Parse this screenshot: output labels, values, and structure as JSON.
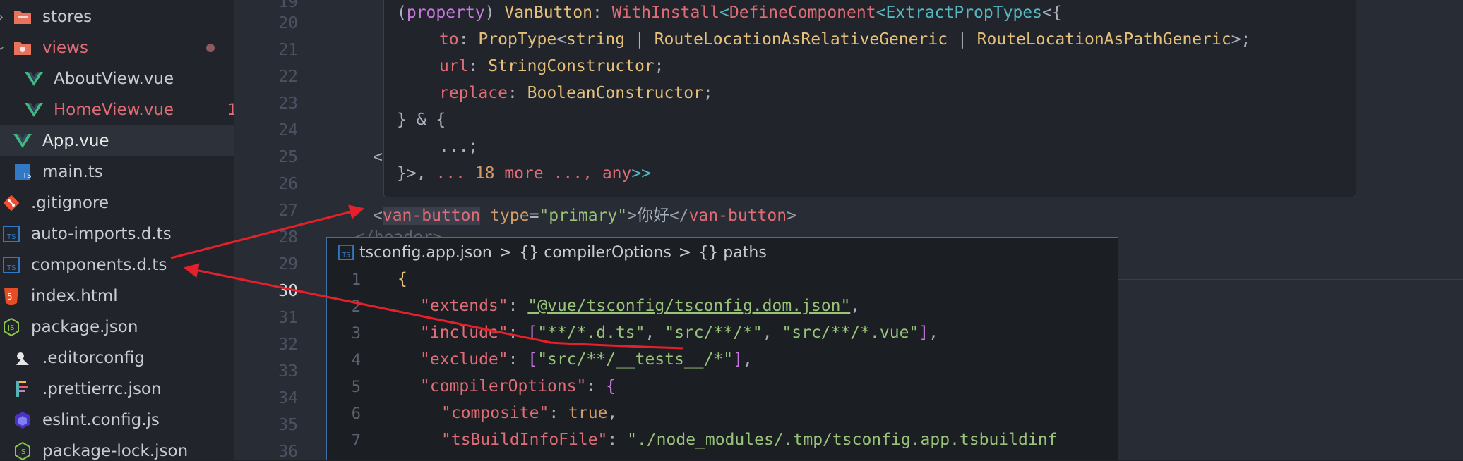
{
  "sidebar": {
    "items": [
      {
        "label": "stores",
        "icon": "folder-icon"
      },
      {
        "label": "views",
        "icon": "folder-open-icon"
      },
      {
        "label": "AboutView.vue",
        "icon": "vue-icon"
      },
      {
        "label": "HomeView.vue",
        "icon": "vue-icon",
        "badge": "1"
      },
      {
        "label": "App.vue",
        "icon": "vue-icon"
      },
      {
        "label": "main.ts",
        "icon": "ts-icon"
      },
      {
        "label": ".gitignore",
        "icon": "git-icon"
      },
      {
        "label": "auto-imports.d.ts",
        "icon": "ts-icon"
      },
      {
        "label": "components.d.ts",
        "icon": "ts-icon"
      },
      {
        "label": "index.html",
        "icon": "html-icon"
      },
      {
        "label": "package.json",
        "icon": "node-icon"
      },
      {
        "label": ".editorconfig",
        "icon": "editorconfig-icon"
      },
      {
        "label": ".prettierrc.json",
        "icon": "prettier-icon"
      },
      {
        "label": "eslint.config.js",
        "icon": "eslint-icon"
      },
      {
        "label": "package-lock.json",
        "icon": "node-icon"
      }
    ]
  },
  "editor": {
    "line_numbers": [
      "19",
      "20",
      "21",
      "22",
      "23",
      "24",
      "25",
      "26",
      "27",
      "28",
      "29",
      "30",
      "31",
      "32",
      "33",
      "34",
      "35",
      "36"
    ],
    "current_line": "30",
    "line25": "<",
    "line27": {
      "open": "<",
      "tag": "van-button",
      "attr": "type",
      "eq": "=",
      "val": "\"primary\"",
      "gt": ">",
      "text": "你好",
      "close_open": "</",
      "close_tag": "van-button",
      "close_gt": ">"
    },
    "line28": "</header>"
  },
  "hover": {
    "l1": {
      "a": "(",
      "b": "property",
      "c": ") ",
      "d": "VanButton",
      "e": ": ",
      "f": "WithInstall",
      "g": "<",
      "h": "DefineComponent",
      "i": "<",
      "j": "ExtractPropTypes",
      "k": "<{"
    },
    "l2": {
      "a": "to",
      "b": ": ",
      "c": "PropType",
      "d": "<",
      "e": "string",
      "f": " | ",
      "g": "RouteLocationAsRelativeGeneric",
      "h": " | ",
      "i": "RouteLocationAsPathGeneric",
      "j": ">;"
    },
    "l3": {
      "a": "url",
      "b": ": ",
      "c": "StringConstructor",
      "d": ";"
    },
    "l4": {
      "a": "replace",
      "b": ": ",
      "c": "BooleanConstructor",
      "d": ";"
    },
    "l5": "} & {",
    "l6": "...;",
    "l7": {
      "a": "}>, ",
      "b": "... ",
      "c": "18",
      "d": " more ..., ",
      "e": "any",
      "f": ">>"
    }
  },
  "peek": {
    "breadcrumb": {
      "file": "tsconfig.app.json",
      "sep1": ">",
      "item1": "{} compilerOptions",
      "sep2": ">",
      "item2": "{} paths"
    },
    "line_numbers": [
      "1",
      "2",
      "3",
      "4",
      "5",
      "6",
      "7"
    ],
    "l1": "{",
    "l2": {
      "key": "\"extends\"",
      "colon": ": ",
      "val": "\"@vue/tsconfig/tsconfig.dom.json\"",
      "end": ","
    },
    "l3": {
      "key": "\"include\"",
      "colon": ": ",
      "ob": "[",
      "v1": "\"**/*.d.ts\"",
      "c1": ", ",
      "v2": "\"src/**/*\"",
      "c2": ", ",
      "v3": "\"src/**/*.vue\"",
      "cb": "]",
      "end": ","
    },
    "l4": {
      "key": "\"exclude\"",
      "colon": ": ",
      "ob": "[",
      "v1": "\"src/**/__tests__/*\"",
      "cb": "]",
      "end": ","
    },
    "l5": {
      "key": "\"compilerOptions\"",
      "colon": ": ",
      "ob": "{"
    },
    "l6": {
      "key": "\"composite\"",
      "colon": ": ",
      "val": "true",
      "end": ","
    },
    "l7": {
      "key": "\"tsBuildInfoFile\"",
      "colon": ": ",
      "val": "\"./node_modules/.tmp/tsconfig.app.tsbuildinf"
    }
  },
  "colors": {
    "annotation_red": "#e5202a",
    "accent_blue": "#3a6fa8"
  }
}
